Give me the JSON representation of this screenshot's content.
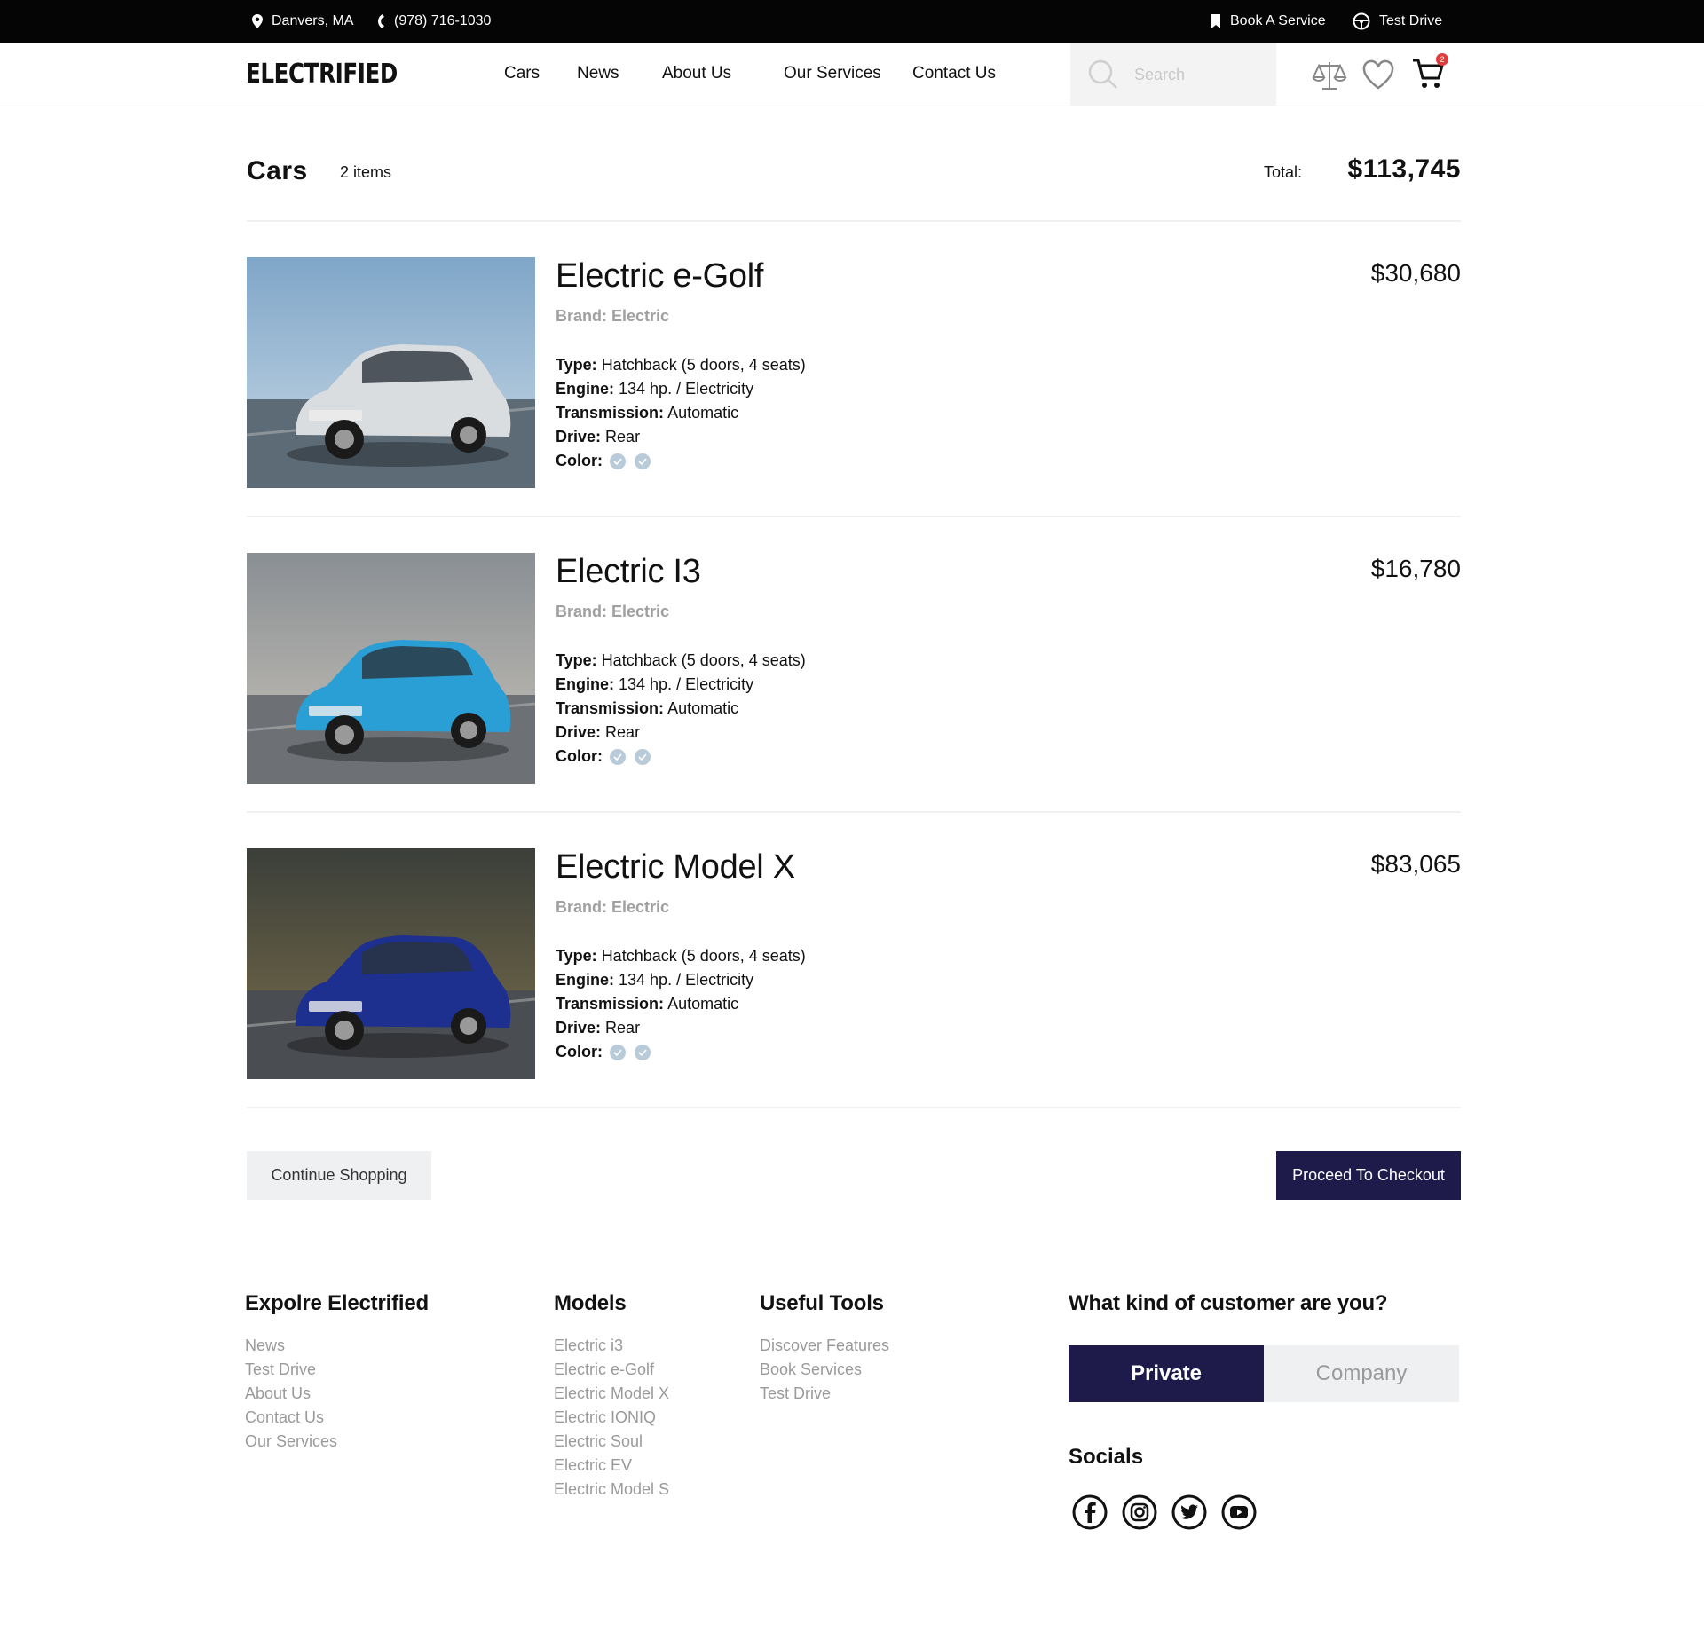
{
  "topbar": {
    "location": "Danvers, MA",
    "phone": "(978) 716-1030",
    "book_service": "Book A Service",
    "test_drive": "Test Drive"
  },
  "header": {
    "logo": "ELECTRIFIED",
    "nav": [
      "Cars",
      "News",
      "About Us",
      "Our Services",
      "Contact Us"
    ],
    "search_placeholder": "Search",
    "cart_badge": "2"
  },
  "cart": {
    "title": "Cars",
    "count": "2 items",
    "total_label": "Total:",
    "total_value": "$113,745",
    "items": [
      {
        "name": "Electric e-Golf",
        "brand": "Brand: Electric",
        "price": "$30,680",
        "type_label": "Type:",
        "type": "Hatchback (5 doors, 4 seats)",
        "engine_label": "Engine:",
        "engine": "134 hp. / Electricity",
        "transmission_label": "Transmission:",
        "transmission": "Automatic",
        "drive_label": "Drive:",
        "drive": "Rear",
        "color_label": "Color:",
        "car_color": "#d9dde0"
      },
      {
        "name": "Electric I3",
        "brand": "Brand: Electric",
        "price": "$16,780",
        "type_label": "Type:",
        "type": "Hatchback (5 doors, 4 seats)",
        "engine_label": "Engine:",
        "engine": "134 hp. / Electricity",
        "transmission_label": "Transmission:",
        "transmission": "Automatic",
        "drive_label": "Drive:",
        "drive": "Rear",
        "color_label": "Color:",
        "car_color": "#2a9fd6"
      },
      {
        "name": "Electric Model X",
        "brand": "Brand: Electric",
        "price": "$83,065",
        "type_label": "Type:",
        "type": "Hatchback (5 doors, 4 seats)",
        "engine_label": "Engine:",
        "engine": "134 hp. / Electricity",
        "transmission_label": "Transmission:",
        "transmission": "Automatic",
        "drive_label": "Drive:",
        "drive": "Rear",
        "color_label": "Color:",
        "car_color": "#1d2f8f"
      }
    ],
    "continue_label": "Continue Shopping",
    "checkout_label": "Proceed To Checkout"
  },
  "footer": {
    "explore": {
      "title": "Expolre Electrified",
      "links": [
        "News",
        "Test Drive",
        "About Us",
        "Contact Us",
        "Our Services"
      ]
    },
    "models": {
      "title": "Models",
      "links": [
        "Electric i3",
        "Electric e-Golf",
        "Electric Model X",
        "Electric IONIQ",
        "Electric Soul",
        "Electric EV",
        "Electric Model S"
      ]
    },
    "tools": {
      "title": "Useful Tools",
      "links": [
        "Discover Features",
        "Book Services",
        "Test Drive"
      ]
    },
    "customer": {
      "title": "What kind of customer are you?",
      "private": "Private",
      "company": "Company"
    },
    "socials_title": "Socials",
    "socials": [
      "facebook-icon",
      "instagram-icon",
      "twitter-icon",
      "youtube-icon"
    ]
  },
  "colors": {
    "accent": "#1e1b4b",
    "muted": "#9a9a9a",
    "light_bg": "#eef0f2"
  }
}
